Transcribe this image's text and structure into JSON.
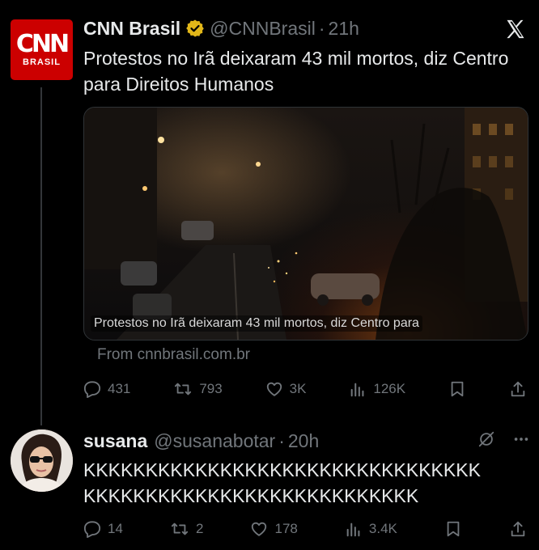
{
  "tweet": {
    "author_name": "CNN Brasil",
    "avatar_logo": "CNN",
    "avatar_sub": "BRASIL",
    "handle": "@CNNBrasil",
    "separator": "·",
    "time": "21h",
    "text": "Protestos no Irã deixaram 43 mil mortos, diz Centro para Direitos Humanos",
    "media_caption": "Protestos no Irã deixaram 43 mil mortos, diz Centro para",
    "link_source": "From cnnbrasil.com.br",
    "stats": {
      "replies": "431",
      "reposts": "793",
      "likes": "3K",
      "views": "126K"
    }
  },
  "reply": {
    "author_name": "susana",
    "handle": "@susanabotar",
    "separator": "·",
    "time": "20h",
    "text_line1": "KKKKKKKKKKKKKKKKKKKKKKKKKKKKKKKK",
    "text_line2": "KKKKKKKKKKKKKKKKKKKKKKKKKKK",
    "stats": {
      "replies": "14",
      "reposts": "2",
      "likes": "178",
      "views": "3.4K"
    }
  },
  "colors": {
    "background": "#000000",
    "text": "#e7e9ea",
    "muted": "#71767b",
    "verified_gold": "#e2b719",
    "cnn_red": "#cc0000"
  },
  "icons": [
    "x-logo-icon",
    "verified-badge-icon",
    "reply-icon",
    "repost-icon",
    "like-icon",
    "views-icon",
    "bookmark-icon",
    "share-icon",
    "grok-icon",
    "more-icon"
  ]
}
